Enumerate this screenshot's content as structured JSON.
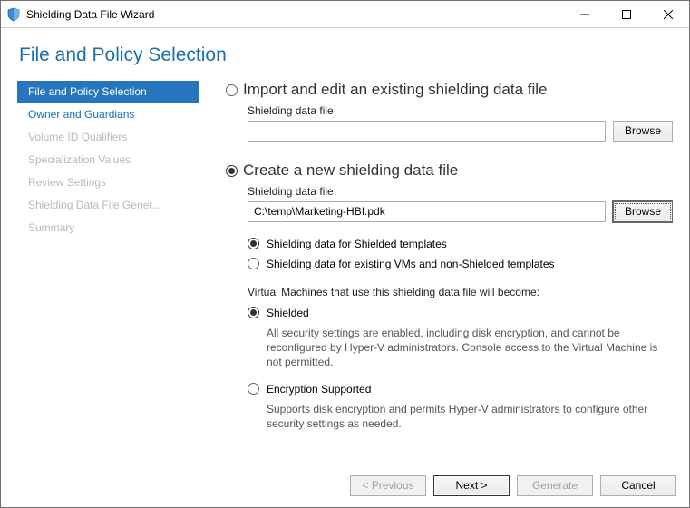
{
  "window": {
    "title": "Shielding Data File Wizard"
  },
  "page": {
    "heading": "File and Policy Selection"
  },
  "sidebar": {
    "items": [
      {
        "label": "File and Policy Selection",
        "state": "active"
      },
      {
        "label": "Owner and Guardians",
        "state": "enabled"
      },
      {
        "label": "Volume ID Qualifiers",
        "state": "disabled"
      },
      {
        "label": "Specialization Values",
        "state": "disabled"
      },
      {
        "label": "Review Settings",
        "state": "disabled"
      },
      {
        "label": "Shielding Data File Gener...",
        "state": "disabled"
      },
      {
        "label": "Summary",
        "state": "disabled"
      }
    ]
  },
  "import": {
    "title": "Import and edit an existing shielding data file",
    "selected": false,
    "file_label": "Shielding data file:",
    "file_value": "",
    "browse_label": "Browse"
  },
  "create": {
    "title": "Create a new shielding data file",
    "selected": true,
    "file_label": "Shielding data file:",
    "file_value": "C:\\temp\\Marketing-HBI.pdk",
    "browse_label": "Browse",
    "template_options": {
      "shielded_templates": {
        "label": "Shielding data for Shielded templates",
        "selected": true
      },
      "existing_vms": {
        "label": "Shielding data for existing VMs and non-Shielded templates",
        "selected": false
      }
    },
    "vm_outcome": {
      "intro": "Virtual Machines that use this shielding data file will become:",
      "shielded": {
        "label": "Shielded",
        "selected": true,
        "desc": "All security settings are enabled, including disk encryption, and cannot be reconfigured by Hyper-V administrators. Console access to the Virtual Machine is not permitted."
      },
      "encryption": {
        "label": "Encryption Supported",
        "selected": false,
        "desc": "Supports disk encryption and permits Hyper-V administrators to configure other security settings as needed."
      }
    }
  },
  "footer": {
    "previous": "< Previous",
    "next": "Next >",
    "generate": "Generate",
    "cancel": "Cancel"
  }
}
